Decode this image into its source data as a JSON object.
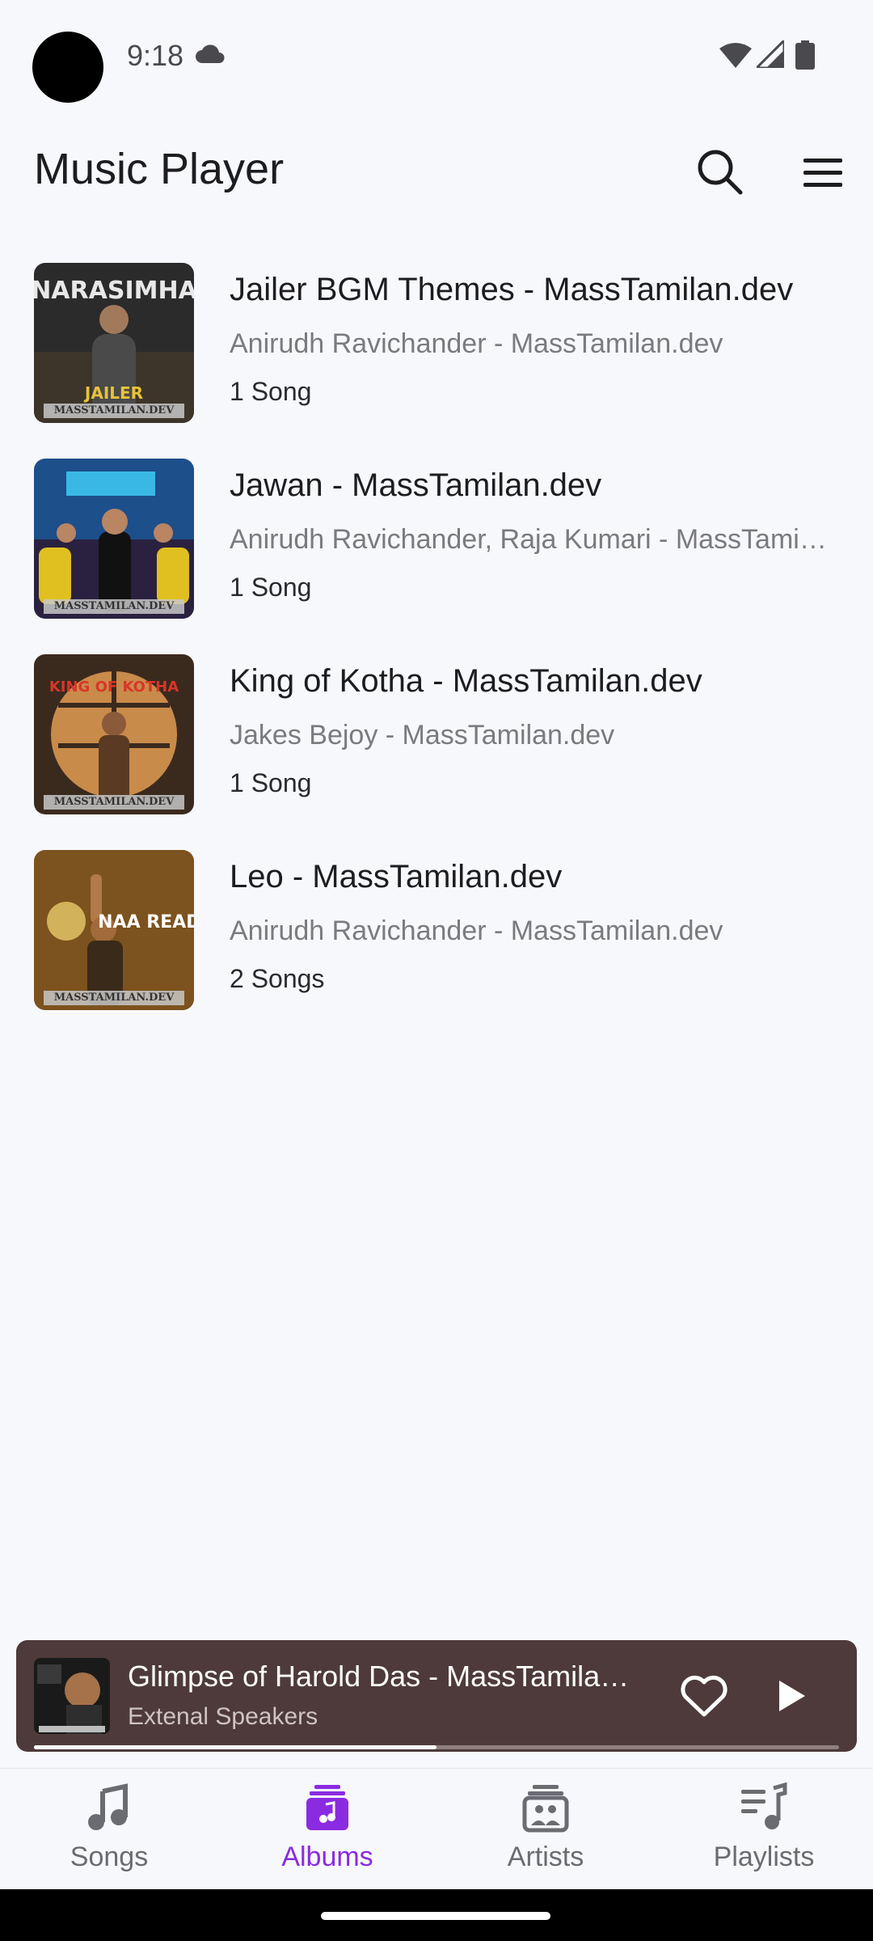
{
  "status_bar": {
    "time": "9:18",
    "icons": [
      "cloud-icon",
      "wifi-icon",
      "signal-icon",
      "battery-icon"
    ]
  },
  "app_bar": {
    "title": "Music Player",
    "icons": [
      "search-icon",
      "menu-icon"
    ]
  },
  "albums": [
    {
      "title": "Jailer BGM Themes - MassTamilan.dev",
      "artist": "Anirudh Ravichander - MassTamilan.dev",
      "count": "1 Song",
      "art_caption": "NARASIMHA",
      "art_sub": "JAILER",
      "art_colors": [
        "#2b2b2b",
        "#6a5a3a"
      ]
    },
    {
      "title": "Jawan - MassTamilan.dev",
      "artist": "Anirudh Ravichander, Raja Kumari - MassTamilan.dev",
      "count": "1 Song",
      "art_caption": "",
      "art_sub": "",
      "art_colors": [
        "#1d4f8a",
        "#d4a017"
      ]
    },
    {
      "title": "King of Kotha - MassTamilan.dev",
      "artist": "Jakes Bejoy - MassTamilan.dev",
      "count": "1 Song",
      "art_caption": "KING OF KOTHA",
      "art_sub": "",
      "art_colors": [
        "#3a2a1e",
        "#b07a3a"
      ]
    },
    {
      "title": "Leo - MassTamilan.dev",
      "artist": "Anirudh Ravichander - MassTamilan.dev",
      "count": "2 Songs",
      "art_caption": "NAA READY",
      "art_sub": "",
      "art_colors": [
        "#6e4a1a",
        "#c9a04a"
      ]
    }
  ],
  "watermark": "MASSTAMILAN.DEV",
  "mini_player": {
    "title": "Glimpse of Harold Das - MassTamilan.dev",
    "subtitle": "Extenal Speakers",
    "progress": 0.5,
    "icons": [
      "heart-icon",
      "play-icon"
    ]
  },
  "bottom_nav": {
    "items": [
      {
        "label": "Songs",
        "icon": "music-note-icon",
        "active": false
      },
      {
        "label": "Albums",
        "icon": "album-icon",
        "active": true
      },
      {
        "label": "Artists",
        "icon": "artist-icon",
        "active": false
      },
      {
        "label": "Playlists",
        "icon": "playlist-icon",
        "active": false
      }
    ]
  },
  "colors": {
    "accent": "#8a2be2",
    "background": "#f7f8fb",
    "mini_player_bg": "#4e3a3a"
  }
}
